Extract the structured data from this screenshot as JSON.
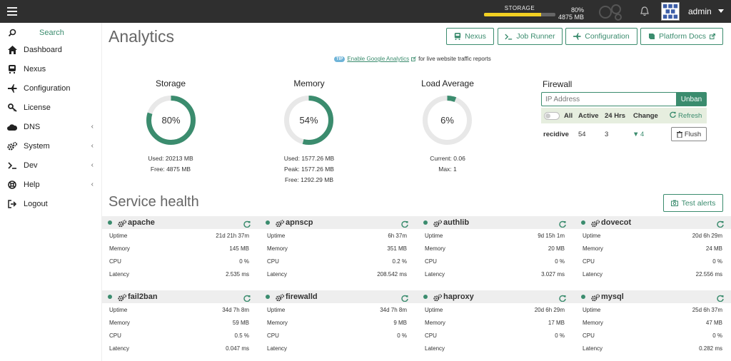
{
  "topbar": {
    "storage_label": "STORAGE",
    "storage_pct": "80%",
    "storage_free": "4875 MB",
    "storage_fraction": 0.8,
    "username": "admin"
  },
  "sidebar": {
    "search": "Search",
    "items": [
      {
        "label": "Dashboard",
        "icon": "home-icon"
      },
      {
        "label": "Nexus",
        "icon": "nexus-icon"
      },
      {
        "label": "Configuration",
        "icon": "plane-icon"
      },
      {
        "label": "License",
        "icon": "key-icon"
      },
      {
        "label": "DNS",
        "icon": "cloud-icon"
      },
      {
        "label": "System",
        "icon": "cogs-icon"
      },
      {
        "label": "Dev",
        "icon": "terminal-icon"
      },
      {
        "label": "Help",
        "icon": "lifebuoy-icon"
      },
      {
        "label": "Logout",
        "icon": "logout-icon"
      }
    ]
  },
  "page": {
    "title": "Analytics",
    "buttons": {
      "nexus": "Nexus",
      "job_runner": "Job Runner",
      "configuration": "Configuration",
      "platform_docs": "Platform Docs"
    },
    "tip_badge": "TIP",
    "tip_link": "Enable Google Analytics",
    "tip_text": "for live website traffic reports"
  },
  "metrics": {
    "storage": {
      "title": "Storage",
      "pct_label": "80%",
      "fraction": 0.8,
      "used": "Used: 20213 MB",
      "free": "Free: 4875 MB"
    },
    "memory": {
      "title": "Memory",
      "pct_label": "54%",
      "fraction": 0.54,
      "used": "Used: 1577.26 MB",
      "peak": "Peak: 1577.26 MB",
      "free": "Free: 1292.29 MB"
    },
    "load": {
      "title": "Load Average",
      "pct_label": "6%",
      "fraction": 0.06,
      "current": "Current: 0.06",
      "max": "Max: 1"
    }
  },
  "firewall": {
    "title": "Firewall",
    "placeholder": "IP Address",
    "unban": "Unban",
    "head": {
      "all": "All",
      "active": "Active",
      "hrs": "24 Hrs",
      "change": "Change",
      "refresh": "Refresh"
    },
    "row": {
      "name": "recidive",
      "active": "54",
      "hrs": "3",
      "change": "4"
    },
    "flush": "Flush"
  },
  "service_health": {
    "title": "Service health",
    "test_alerts": "Test alerts",
    "labels": {
      "uptime": "Uptime",
      "memory": "Memory",
      "cpu": "CPU",
      "latency": "Latency"
    },
    "services": [
      {
        "name": "apache",
        "uptime": "21d 21h 37m",
        "memory": "145 MB",
        "cpu": "0 %",
        "latency": "2.535 ms"
      },
      {
        "name": "apnscp",
        "uptime": "6h 37m",
        "memory": "351 MB",
        "cpu": "0.2 %",
        "latency": "208.542 ms"
      },
      {
        "name": "authlib",
        "uptime": "9d 15h 1m",
        "memory": "20 MB",
        "cpu": "0 %",
        "latency": "3.027 ms"
      },
      {
        "name": "dovecot",
        "uptime": "20d 6h 29m",
        "memory": "24 MB",
        "cpu": "0 %",
        "latency": "22.556 ms"
      },
      {
        "name": "fail2ban",
        "uptime": "34d 7h 8m",
        "memory": "59 MB",
        "cpu": "0.5 %",
        "latency": "0.047 ms"
      },
      {
        "name": "firewalld",
        "uptime": "34d 7h 8m",
        "memory": "9 MB",
        "cpu": "0 %",
        "latency": ""
      },
      {
        "name": "haproxy",
        "uptime": "20d 6h 29m",
        "memory": "17 MB",
        "cpu": "0 %",
        "latency": ""
      },
      {
        "name": "mysql",
        "uptime": "25d 6h 37m",
        "memory": "47 MB",
        "cpu": "0 %",
        "latency": "0.282 ms"
      }
    ]
  },
  "colors": {
    "accent": "#3b8c6e",
    "ring_track": "#e8e8e8",
    "storage_bar": "#f2d022"
  }
}
